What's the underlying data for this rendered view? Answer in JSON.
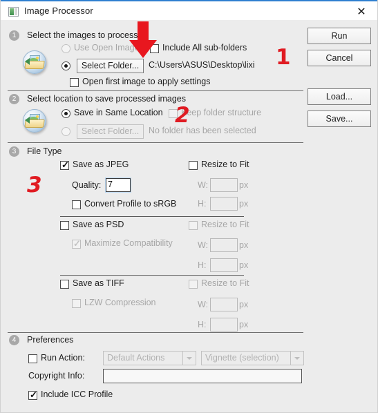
{
  "window": {
    "title": "Image Processor",
    "icon": "image-processor-icon",
    "close_label": "✕"
  },
  "side_buttons": [
    {
      "name": "run-button",
      "label": "Run"
    },
    {
      "name": "cancel-button",
      "label": "Cancel"
    },
    {
      "name": "load-button",
      "label": "Load..."
    },
    {
      "name": "save-button",
      "label": "Save..."
    }
  ],
  "section1": {
    "number": "1",
    "title": "Select the images to process",
    "use_open_images": {
      "label": "Use Open Images",
      "checked": false,
      "enabled": false
    },
    "include_sub_folders": {
      "label": "Include All sub-folders",
      "checked": false
    },
    "select_folder_button": "Select Folder...",
    "folder_path": "C:\\Users\\ASUS\\Desktop\\lixi",
    "select_folder_radio_checked": true,
    "open_first_image": {
      "label": "Open first image to apply settings",
      "checked": false
    }
  },
  "section2": {
    "number": "2",
    "title": "Select location to save processed images",
    "save_same_location": {
      "label": "Save in Same Location",
      "checked": true
    },
    "keep_folder_structure": {
      "label": "Keep folder structure",
      "checked": false,
      "enabled": false
    },
    "select_folder_button": "Select Folder...",
    "no_folder_text": "No folder has been selected",
    "select_folder_radio_checked": false
  },
  "section3": {
    "number": "3",
    "title": "File Type",
    "jpeg": {
      "label": "Save as JPEG",
      "checked": true,
      "quality_label": "Quality:",
      "quality_value": "7",
      "convert_srgb": {
        "label": "Convert Profile to sRGB",
        "checked": false
      },
      "resize_to_fit": {
        "label": "Resize to Fit",
        "checked": false,
        "enabled": true
      },
      "w_label": "W:",
      "w_value": "",
      "h_label": "H:",
      "h_value": "",
      "px": "px"
    },
    "psd": {
      "label": "Save as PSD",
      "checked": false,
      "maximize_compatibility": {
        "label": "Maximize Compatibility",
        "checked": true,
        "enabled": false
      },
      "resize_to_fit": {
        "label": "Resize to Fit",
        "checked": false,
        "enabled": false
      },
      "w_label": "W:",
      "w_value": "",
      "h_label": "H:",
      "h_value": "",
      "px": "px"
    },
    "tiff": {
      "label": "Save as TIFF",
      "checked": false,
      "lzw_compression": {
        "label": "LZW Compression",
        "checked": false,
        "enabled": false
      },
      "resize_to_fit": {
        "label": "Resize to Fit",
        "checked": false,
        "enabled": false
      },
      "w_label": "W:",
      "w_value": "",
      "h_label": "H:",
      "h_value": "",
      "px": "px"
    }
  },
  "section4": {
    "number": "4",
    "title": "Preferences",
    "run_action": {
      "label": "Run Action:",
      "checked": false
    },
    "action_set_value": "Default Actions",
    "action_value": "Vignette (selection)",
    "copyright_label": "Copyright Info:",
    "copyright_value": "",
    "include_icc": {
      "label": "Include ICC Profile",
      "checked": true
    }
  },
  "annotations": {
    "color": "#e01b22",
    "arrow": "down-arrow-annotation",
    "one": "1",
    "two": "2",
    "three": "3"
  }
}
